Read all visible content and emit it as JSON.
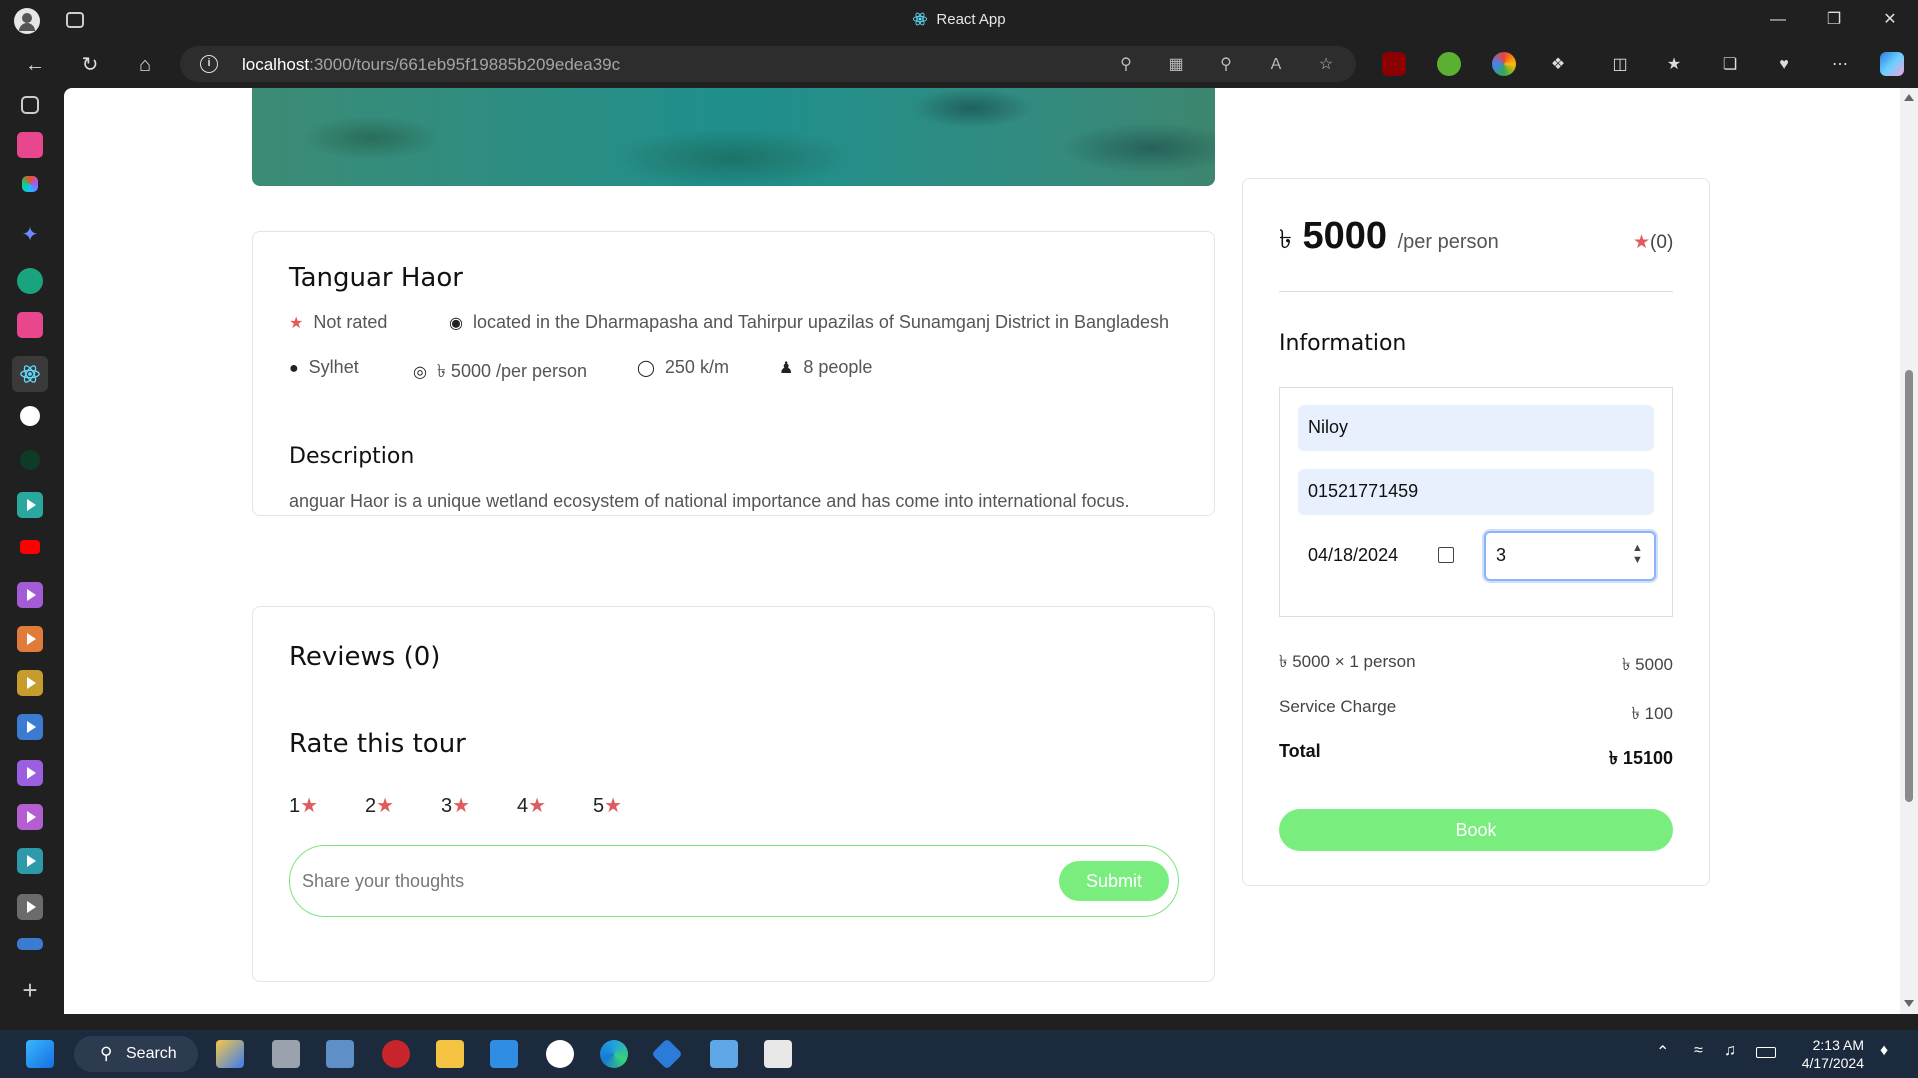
{
  "window": {
    "title": "React App"
  },
  "address": {
    "url_host": "localhost",
    "url_path": ":3000/tours/661eb95f19885b209edea39c"
  },
  "tour": {
    "title": "Tanguar Haor",
    "rating": "Not rated",
    "location": "located in the Dharmapasha and Tahirpur upazilas of Sunamganj District in Bangladesh",
    "city": "Sylhet",
    "price": "৳ 5000 /per person",
    "distance": "250 k/m",
    "group_size": "8 people",
    "description_heading": "Description",
    "description": "anguar Haor is a unique wetland ecosystem of national importance and has come into international focus."
  },
  "reviews": {
    "heading": "Reviews (0)",
    "rate_heading": "Rate this tour",
    "rate_options": [
      "1",
      "2",
      "3",
      "4",
      "5"
    ],
    "placeholder": "Share your thoughts",
    "submit_label": "Submit"
  },
  "booking": {
    "currency": "৳",
    "price": "5000",
    "unit": "/per person",
    "rating_count": "(0)",
    "info_heading": "Information",
    "name": "Niloy",
    "phone": "01521771459",
    "date": "04/18/2024",
    "guests": "3",
    "line1_label": "৳ 5000 × 1 person",
    "line1_value": "৳ 5000",
    "service_label": "Service Charge",
    "service_value": "৳ 100",
    "total_label": "Total",
    "total_value": "৳ 15100",
    "book_label": "Book"
  },
  "taskbar": {
    "search_label": "Search",
    "time": "2:13 AM",
    "date": "4/17/2024"
  },
  "colors": {
    "accent_green": "#7aed7f",
    "star_red": "#e05c5c",
    "input_bg": "#e8f0fe"
  }
}
